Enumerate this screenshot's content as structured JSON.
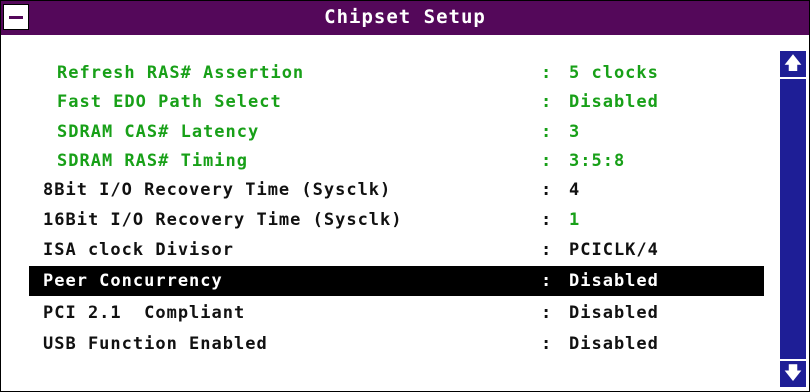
{
  "window": {
    "title": "Chipset Setup"
  },
  "settings": [
    {
      "label": "Refresh RAS# Assertion",
      "colon": ":",
      "value": "5 clocks",
      "style": "green"
    },
    {
      "label": "Fast EDO Path Select",
      "colon": ":",
      "value": "Disabled",
      "style": "green"
    },
    {
      "label": "SDRAM CAS# Latency",
      "colon": ":",
      "value": "3",
      "style": "green"
    },
    {
      "label": "SDRAM RAS# Timing",
      "colon": ":",
      "value": "3:5:8",
      "style": "green"
    },
    {
      "label": "8Bit I/O Recovery Time (Sysclk)",
      "colon": ":",
      "value": "4",
      "style": "normal"
    },
    {
      "label": "16Bit I/O Recovery Time (Sysclk)",
      "colon": ":",
      "value": "1",
      "style": "normal-green-value"
    },
    {
      "label": "ISA clock Divisor",
      "colon": ":",
      "value": "PCICLK/4",
      "style": "normal"
    },
    {
      "label": "Peer Concurrency",
      "colon": ":",
      "value": "Disabled",
      "style": "selected"
    },
    {
      "label": "PCI 2.1  Compliant",
      "colon": ":",
      "value": "Disabled",
      "style": "normal"
    },
    {
      "label": "USB Function Enabled",
      "colon": ":",
      "value": "Disabled",
      "style": "normal"
    }
  ],
  "scrollbar": {
    "up_icon": "arrow-up-icon",
    "down_icon": "arrow-down-icon"
  },
  "colors": {
    "title_bar": "#54085a",
    "green_text": "#18a018",
    "scrollbar": "#1e1e96",
    "selection": "#000000"
  }
}
